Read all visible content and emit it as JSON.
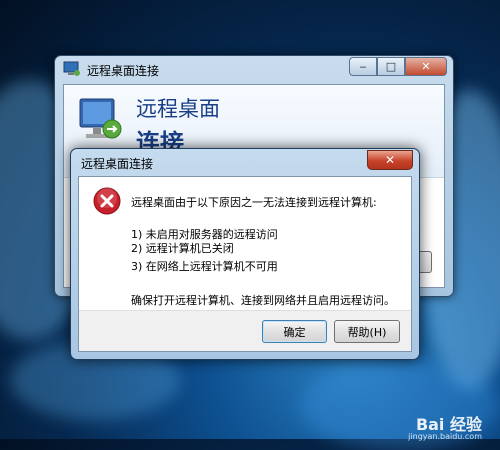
{
  "background_window": {
    "title": "远程桌面连接",
    "banner_line1": "远程桌面",
    "banner_line2": "连接",
    "minimize_glyph": "‒",
    "maximize_glyph": "□",
    "close_glyph": "✕"
  },
  "dialog": {
    "title": "远程桌面连接",
    "close_glyph": "✕",
    "message_intro": "远程桌面由于以下原因之一无法连接到远程计算机:",
    "reasons": [
      "1) 未启用对服务器的远程访问",
      "2) 远程计算机已关闭",
      "3) 在网络上远程计算机不可用"
    ],
    "message_outro": "确保打开远程计算机、连接到网络并且启用远程访问。",
    "ok_label": "确定",
    "help_label": "帮助(H)"
  },
  "watermark": {
    "brand": "Bai 经验",
    "url": "jingyan.baidu.com"
  },
  "colors": {
    "desktop_blue": "#0d4f8f",
    "title_text": "#1a3f86",
    "close_red": "#c7432a"
  }
}
